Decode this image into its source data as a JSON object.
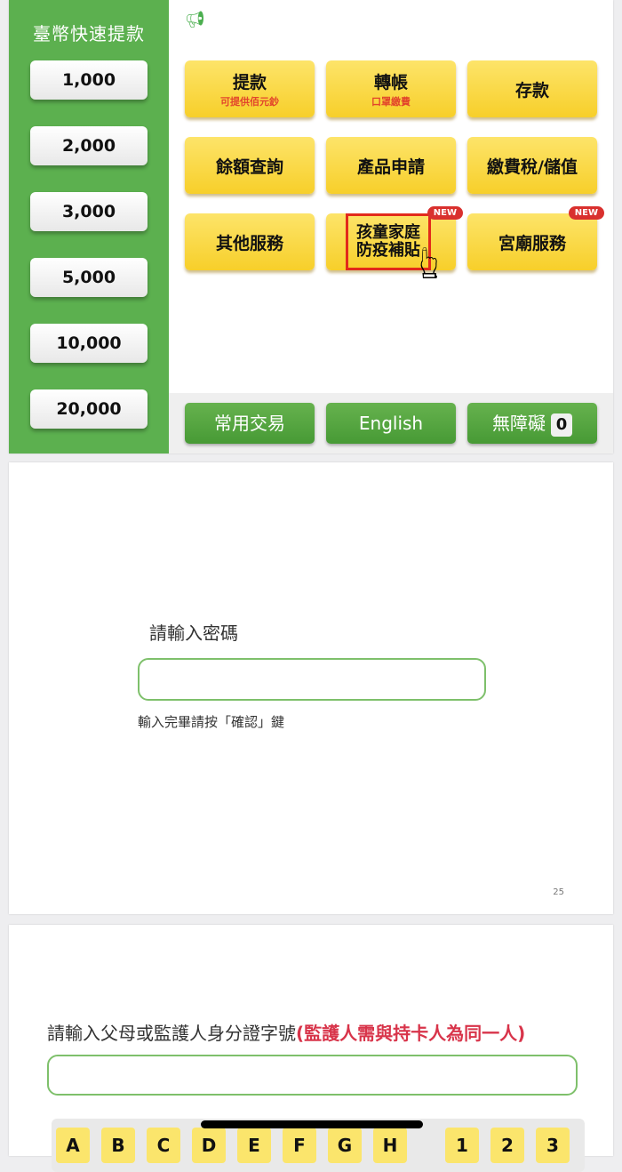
{
  "menu": {
    "sidebar": {
      "title": "臺幣快速提款",
      "amounts": [
        "1,000",
        "2,000",
        "3,000",
        "5,000",
        "10,000",
        "20,000"
      ]
    },
    "announcement_icon": "megaphone-icon",
    "buttons": [
      {
        "label": "提款",
        "sub": "可提供佰元鈔"
      },
      {
        "label": "轉帳",
        "sub": "口罩繳費"
      },
      {
        "label": "存款"
      },
      {
        "label": "餘額查詢"
      },
      {
        "label": "產品申請"
      },
      {
        "label": "繳費稅/儲值"
      },
      {
        "label": "其他服務"
      },
      {
        "line1": "孩童家庭",
        "line2": "防疫補貼",
        "badge": "NEW"
      },
      {
        "label": "宮廟服務",
        "badge": "NEW"
      }
    ],
    "bottom": {
      "common": "常用交易",
      "english": "English",
      "accessible": "無障礙",
      "accessible_key": "0"
    }
  },
  "pin": {
    "label": "請輸入密碼",
    "value": "",
    "hint": "輸入完畢請按「確認」鍵",
    "page": "25"
  },
  "id": {
    "label": "請輸入父母或監護人身分證字號",
    "warning": "(監護人需與持卡人為同一人)",
    "value": "",
    "letters": [
      "A",
      "B",
      "C",
      "D",
      "E",
      "F",
      "G",
      "H"
    ],
    "digits": [
      "1",
      "2",
      "3"
    ]
  },
  "colors": {
    "green": "#5cb04f",
    "yellow": "#f7cf2a",
    "red": "#d9302e"
  }
}
